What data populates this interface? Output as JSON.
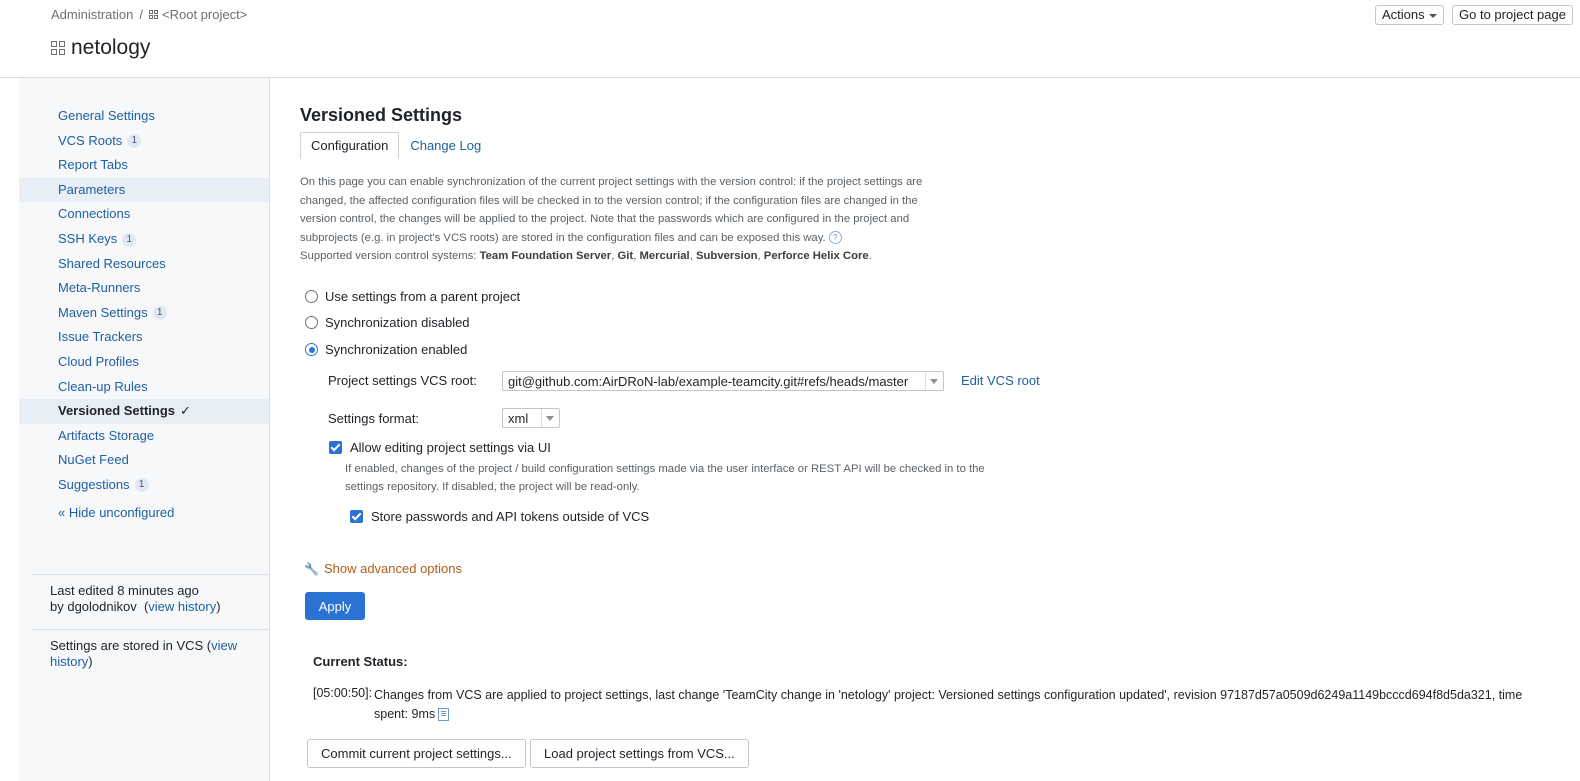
{
  "header": {
    "breadcrumb_admin": "Administration",
    "breadcrumb_sep": "/",
    "breadcrumb_root": "<Root project>",
    "project_title": "netology",
    "actions_label": "Actions",
    "goto_label": "Go to project page"
  },
  "sidebar": {
    "items": [
      {
        "label": "General Settings"
      },
      {
        "label": "VCS Roots",
        "badge": "1"
      },
      {
        "label": "Report Tabs"
      },
      {
        "label": "Parameters"
      },
      {
        "label": "Connections"
      },
      {
        "label": "SSH Keys",
        "badge": "1"
      },
      {
        "label": "Shared Resources"
      },
      {
        "label": "Meta-Runners"
      },
      {
        "label": "Maven Settings",
        "badge": "1"
      },
      {
        "label": "Issue Trackers"
      },
      {
        "label": "Cloud Profiles"
      },
      {
        "label": "Clean-up Rules"
      },
      {
        "label": "Versioned Settings",
        "check": "✓"
      },
      {
        "label": "Artifacts Storage"
      },
      {
        "label": "NuGet Feed"
      },
      {
        "label": "Suggestions",
        "badge": "1"
      }
    ],
    "hide_unconfigured": "« Hide unconfigured",
    "last_edited": "Last edited 8 minutes ago",
    "edited_by": "by dgolodnikov",
    "view_history": "view history",
    "stored_text": "Settings are stored in VCS (",
    "stored_link": "view history",
    "stored_close": ")"
  },
  "main": {
    "title": "Versioned Settings",
    "tabs": [
      {
        "label": "Configuration"
      },
      {
        "label": "Change Log"
      }
    ],
    "description": "On this page you can enable synchronization of the current project settings with the version control: if the project settings are changed, the affected configuration files will be checked in to the version control; if the configuration files are changed in the version control, the changes will be applied to the project. Note that the passwords which are configured in the project and subprojects (e.g. in project's VCS roots) are stored in the configuration files and can be exposed this way.",
    "supported_prefix": "Supported version control systems: ",
    "vcs_systems": [
      "Team Foundation Server",
      "Git",
      "Mercurial",
      "Subversion",
      "Perforce Helix Core"
    ],
    "radios": {
      "parent": "Use settings from a parent project",
      "disabled": "Synchronization disabled",
      "enabled": "Synchronization enabled"
    },
    "vcs_root_label": "Project settings VCS root:",
    "vcs_root_value": "git@github.com:AirDRoN-lab/example-teamcity.git#refs/heads/master",
    "edit_vcs_root": "Edit VCS root",
    "format_label": "Settings format:",
    "format_value": "xml",
    "allow_editing_label": "Allow editing project settings via UI",
    "allow_editing_hint": "If enabled, changes of the project / build configuration settings made via the user interface or REST API will be checked in to the settings repository. If disabled, the project will be read-only.",
    "store_passwords_label": "Store passwords and API tokens outside of VCS",
    "advanced_options": "Show advanced options",
    "apply": "Apply",
    "status_title": "Current Status:",
    "status_time": "[05:00:50]:",
    "status_message": "Changes from VCS are applied to project settings, last change 'TeamCity change in 'netology' project: Versioned settings configuration updated', revision 97187d57a0509d6249a1149bcccd694f8d5da321, time spent: 9ms",
    "commit_button": "Commit current project settings...",
    "load_button": "Load project settings from VCS..."
  }
}
